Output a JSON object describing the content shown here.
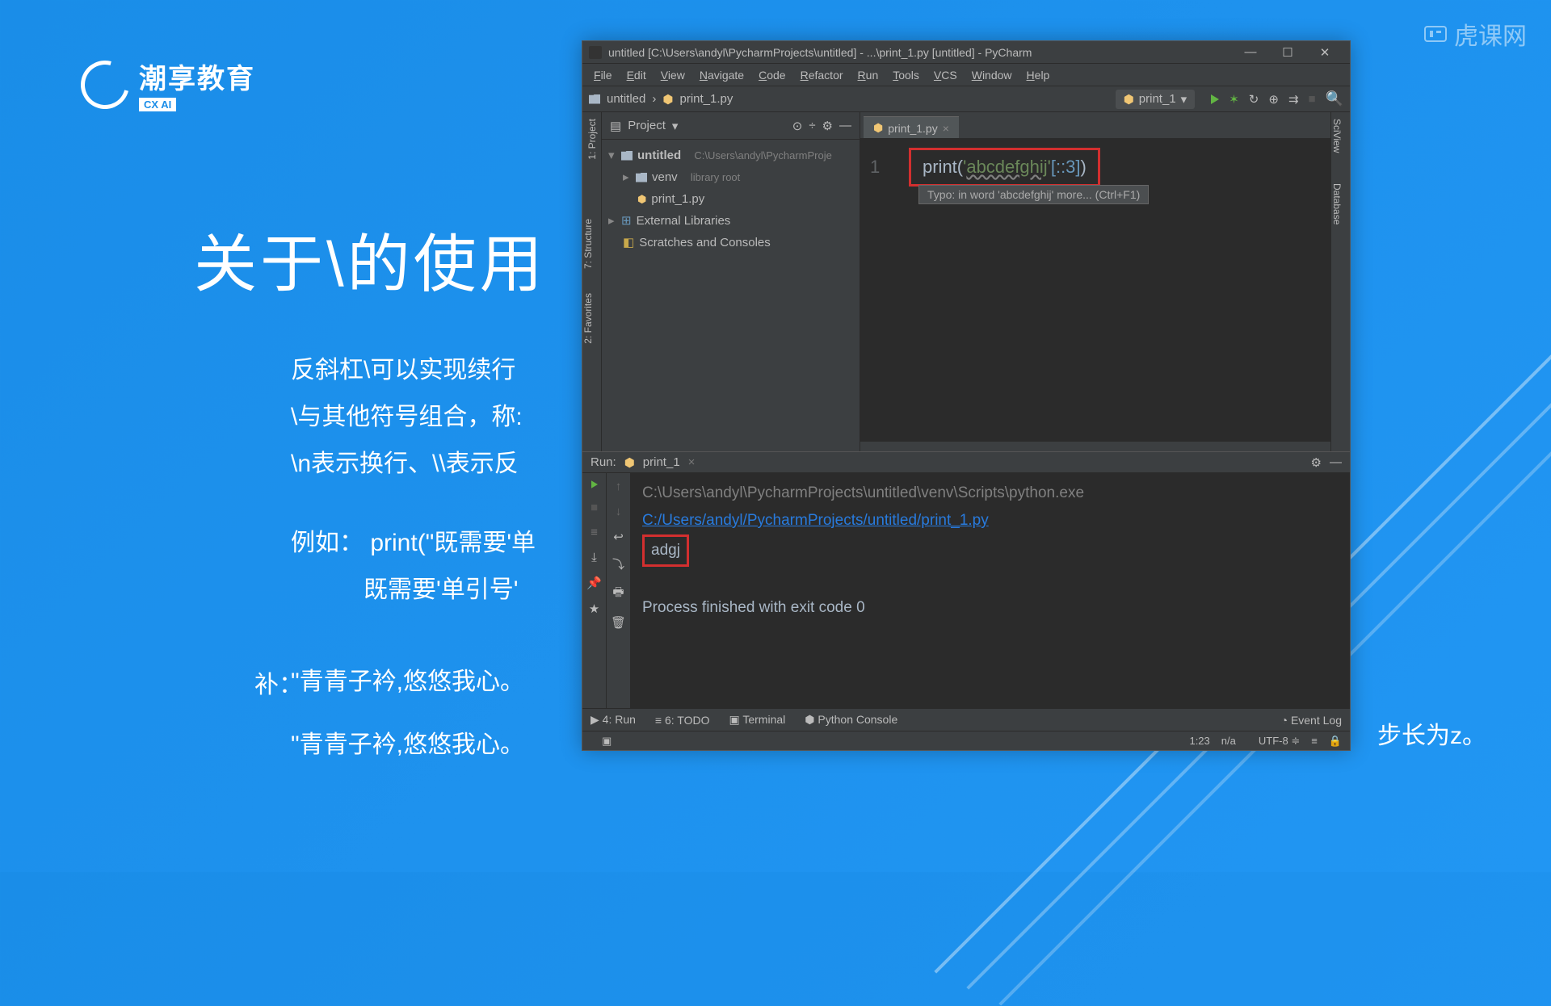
{
  "watermark": "虎课网",
  "logo": {
    "cn": "潮享教育",
    "en": "CX AI"
  },
  "slide": {
    "title": "关于\\的使用",
    "lines": [
      "反斜杠\\可以实现续行",
      "\\与其他符号组合，称:",
      "\\n表示换行、\\\\表示反",
      "",
      "例如： print(\"既需要'单",
      "　　　既需要'单引号'"
    ],
    "suppl_label": "补：",
    "poem1": "\"青青子衿,悠悠我心。",
    "poem2": "\"青青子衿,悠悠我心。",
    "extra": "步长为z。"
  },
  "ide": {
    "title": "untitled [C:\\Users\\andyl\\PycharmProjects\\untitled] - ...\\print_1.py [untitled] - PyCharm",
    "menus": [
      "File",
      "Edit",
      "View",
      "Navigate",
      "Code",
      "Refactor",
      "Run",
      "Tools",
      "VCS",
      "Window",
      "Help"
    ],
    "breadcrumbs": [
      "untitled",
      "print_1.py"
    ],
    "run_config": "print_1",
    "project_label": "Project",
    "tree": {
      "root": "untitled",
      "root_path": "C:\\Users\\andyl\\PycharmProje",
      "venv": "venv",
      "venv_note": "library root",
      "file": "print_1.py",
      "ext_lib": "External Libraries",
      "scratches": "Scratches and Consoles"
    },
    "tab": "print_1.py",
    "code": {
      "line_no": "1",
      "fn": "print",
      "open": "(",
      "q1": "'",
      "str": "abcdefghij",
      "q2": "'",
      "slice": "[::3]",
      "close": ")"
    },
    "hint": "Typo: in word 'abcdefghij' more... (Ctrl+F1)",
    "sideview": "SciView",
    "database": "Database",
    "left_tabs": {
      "project": "1: Project",
      "structure": "7: Structure",
      "favorites": "2: Favorites"
    },
    "run": {
      "label": "Run:",
      "name": "print_1",
      "line1": "C:\\Users\\andyl\\PycharmProjects\\untitled\\venv\\Scripts\\python.exe ",
      "line1b": "C:/Users/andyl/PycharmProjects/untitled/print_1.py",
      "out": "adgj",
      "exit": "Process finished with exit code 0"
    },
    "bottom": {
      "run": "4: Run",
      "todo": "6: TODO",
      "terminal": "Terminal",
      "pyconsole": "Python Console",
      "eventlog": "Event Log"
    },
    "status": {
      "pos": "1:23",
      "insp": "n/a",
      "enc": "UTF-8",
      "sep": "≡"
    }
  }
}
